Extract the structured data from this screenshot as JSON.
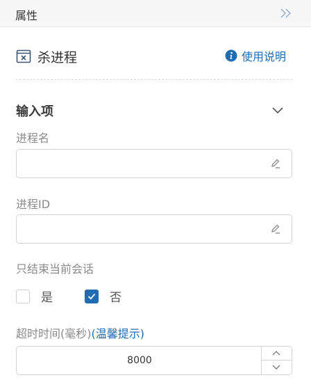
{
  "panel": {
    "title": "属性",
    "collapse_icon": "double-chevron-right-icon"
  },
  "action": {
    "name": "杀进程",
    "icon": "window-close-icon",
    "help_label": "使用说明",
    "help_icon": "info-icon"
  },
  "inputs_section": {
    "title": "输入项",
    "toggle_icon": "chevron-down-icon"
  },
  "fields": {
    "process_name": {
      "label": "进程名",
      "value": ""
    },
    "process_id": {
      "label": "进程ID",
      "value": ""
    }
  },
  "current_session": {
    "label": "只结束当前会话",
    "options": [
      {
        "label": "是",
        "checked": false
      },
      {
        "label": "否",
        "checked": true
      }
    ]
  },
  "timeout": {
    "label": "超时时间(毫秒)",
    "hint": "(温馨提示)",
    "value": "8000"
  },
  "colors": {
    "accent": "#1f6cb5",
    "label": "#8a8a8a",
    "border": "#d3d3d3"
  }
}
